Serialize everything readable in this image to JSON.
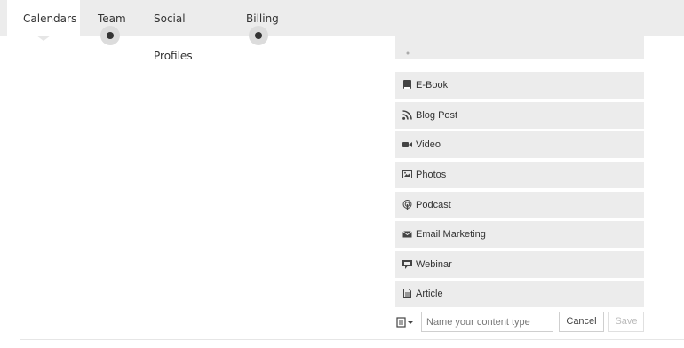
{
  "tabs": [
    {
      "label": "Calendars",
      "active": true
    },
    {
      "label": "Team"
    },
    {
      "label": "Social Profiles"
    },
    {
      "label": "Billing"
    }
  ],
  "content_types": [
    {
      "label": "",
      "icon": "truncated-row"
    },
    {
      "label": "E-Book",
      "icon": "book-icon"
    },
    {
      "label": "Blog Post",
      "icon": "rss-icon"
    },
    {
      "label": "Video",
      "icon": "video-camera-icon"
    },
    {
      "label": "Photos",
      "icon": "image-icon"
    },
    {
      "label": "Podcast",
      "icon": "podcast-icon"
    },
    {
      "label": "Email Marketing",
      "icon": "envelope-icon"
    },
    {
      "label": "Webinar",
      "icon": "presentation-icon"
    },
    {
      "label": "Article",
      "icon": "document-icon"
    }
  ],
  "add_form": {
    "placeholder": "Name your content type",
    "value": "",
    "cancel_label": "Cancel",
    "save_label": "Save"
  },
  "colors": {
    "tab_bar": "#ececec",
    "row_background": "#ececec",
    "text": "#333333"
  }
}
